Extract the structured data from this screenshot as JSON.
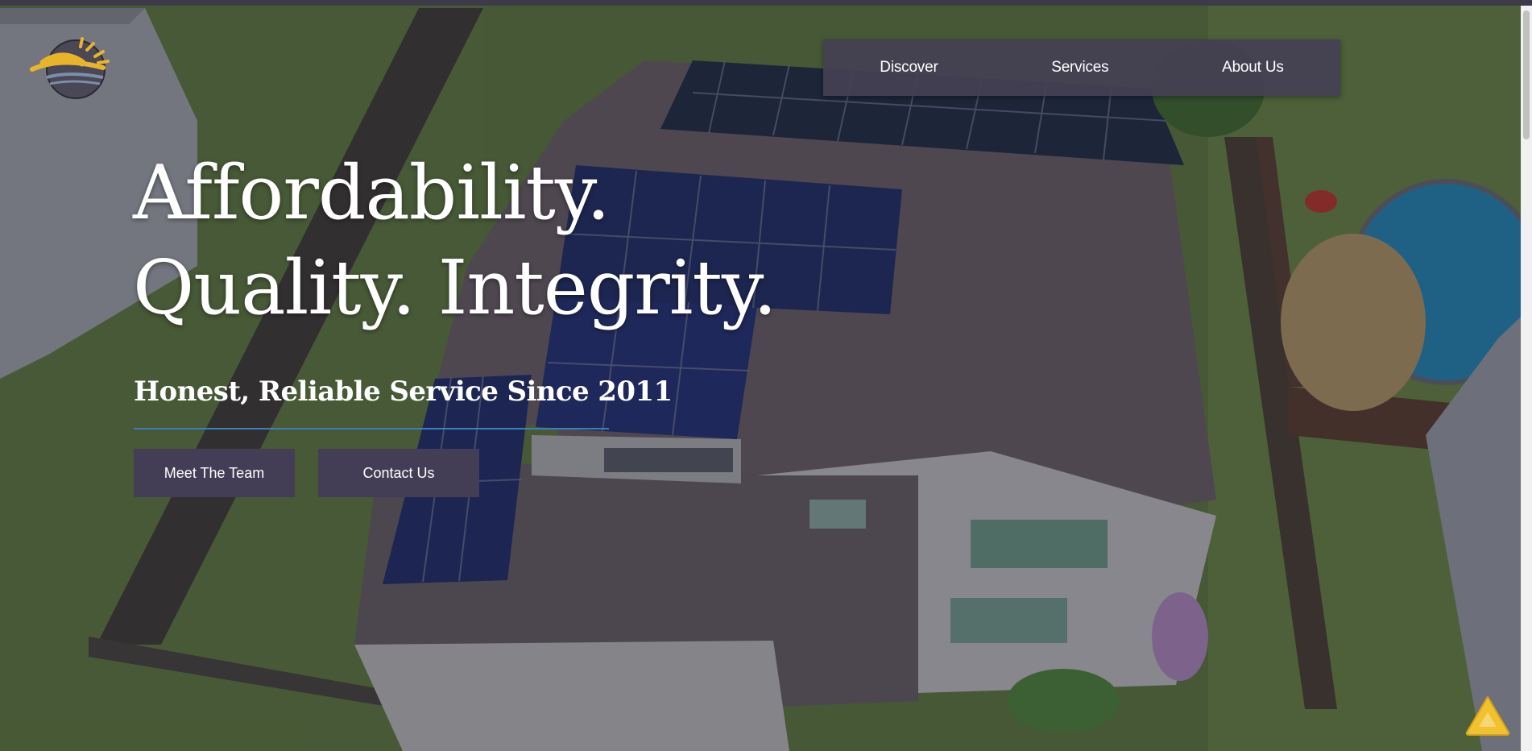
{
  "nav": {
    "items": [
      {
        "label": "Discover"
      },
      {
        "label": "Services"
      },
      {
        "label": "About Us"
      }
    ]
  },
  "hero": {
    "headline_line1": "Affordability.",
    "headline_line2": "Quality. Integrity.",
    "subheadline": "Honest, Reliable Service Since 2011",
    "buttons": {
      "meet_team": "Meet The Team",
      "contact": "Contact Us"
    }
  },
  "icons": {
    "logo": "sun-over-water-logo",
    "badge": "accessibility-badge-icon"
  },
  "colors": {
    "nav_bg": "#444054",
    "button_bg": "#433e55",
    "divider": "#3e7fb8",
    "logo_gold": "#e8b52a",
    "badge_gold": "#f2c12e"
  }
}
